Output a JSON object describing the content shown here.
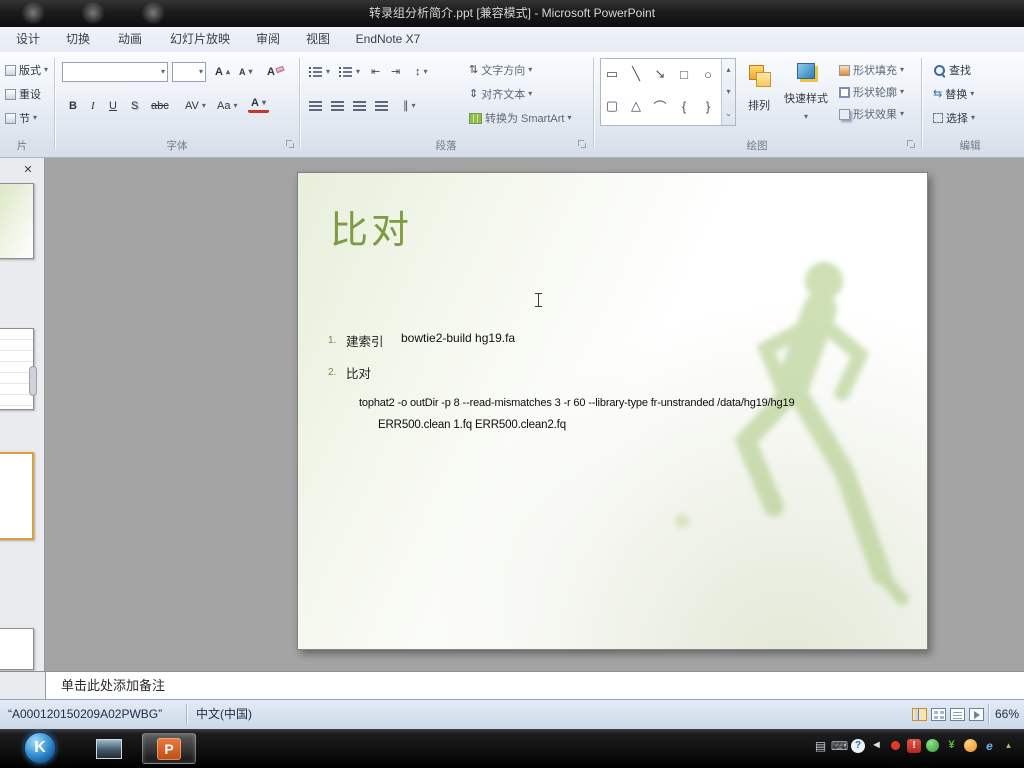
{
  "title_bar": {
    "title": "转录组分析简介.ppt [兼容模式] - Microsoft PowerPoint"
  },
  "ribbon": {
    "tabs": [
      {
        "label": "设计"
      },
      {
        "label": "切换"
      },
      {
        "label": "动画"
      },
      {
        "label": "幻灯片放映"
      },
      {
        "label": "审阅"
      },
      {
        "label": "视图"
      },
      {
        "label": "EndNote X7"
      }
    ],
    "slides_group": {
      "layout": "版式",
      "reset": "重设",
      "section": "节",
      "label_fragment": "片"
    },
    "font_group": {
      "label": "字体",
      "bold": "B",
      "italic": "I",
      "underline": "U",
      "shadow": "S",
      "strike": "abc",
      "spacing": "AV",
      "change_case": "Aa",
      "font_color": "A",
      "grow": "A",
      "shrink": "A"
    },
    "paragraph_group": {
      "label": "段落",
      "text_direction": "文字方向",
      "align_text": "对齐文本",
      "smartart": "转换为 SmartArt"
    },
    "drawing_group": {
      "label": "绘图",
      "arrange": "排列",
      "quick_styles": "快速样式",
      "shape_fill": "形状填充",
      "shape_outline": "形状轮廓",
      "shape_effects": "形状效果"
    },
    "editing_group": {
      "label": "编辑",
      "find": "查找",
      "replace": "替换",
      "select": "选择"
    }
  },
  "slide": {
    "title": "比对",
    "items": [
      {
        "num": "1.",
        "label": "建索引",
        "code": "bowtie2-build hg19.fa"
      },
      {
        "num": "2.",
        "label": "比对"
      }
    ],
    "code_line_1": "tophat2 -o outDir -p 8 --read-mismatches 3 -r 60 --library-type fr-unstranded /data/hg19/hg19",
    "code_line_2": "ERR500.clean 1.fq ERR500.clean2.fq"
  },
  "notes": {
    "placeholder": "单击此处添加备注"
  },
  "status_bar": {
    "template": "“A000120150209A02PWBG”",
    "language": "中文(中国)",
    "zoom": "66%"
  },
  "taskbar": {
    "start": "K"
  },
  "icons": {
    "close": "✕",
    "caret": "▾",
    "up": "▴",
    "more": "⌄",
    "outdent": "⇤",
    "indent": "⇥",
    "line_spacing": "↕",
    "columns": "∥",
    "text_direction": "⇅",
    "align_text": "⇕",
    "replace": "⇆",
    "shape_textbox": "▭",
    "shape_line": "╲",
    "shape_arrow": "↘",
    "shape_rect": "□",
    "shape_oval": "○",
    "shape_rrect": "▢",
    "shape_tri": "△",
    "shape_arc": "⌒",
    "shape_brace_l": "{",
    "shape_brace_r": "}",
    "help": "?",
    "volume": "◄",
    "shield": "!",
    "yen": "¥",
    "browser": "e",
    "printer": "▤",
    "keyboard": "⌨",
    "tray_up": "▴",
    "ppt": "P"
  }
}
